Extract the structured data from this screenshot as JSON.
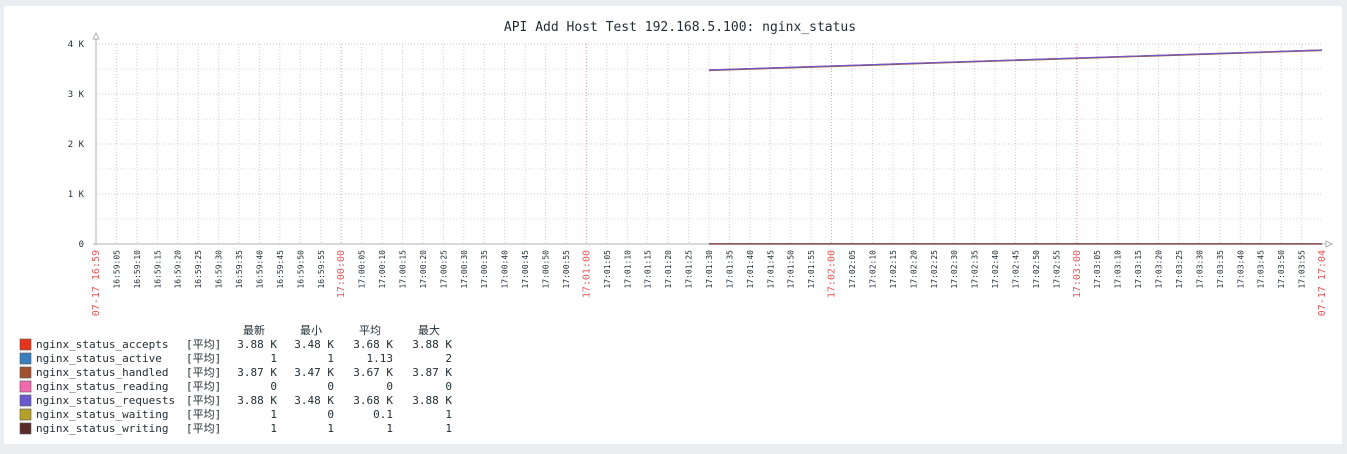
{
  "chart_data": {
    "type": "line",
    "title": "API Add Host Test 192.168.5.100: nginx_status",
    "y_ticks": [
      "0",
      "1 K",
      "2 K",
      "3 K",
      "4 K"
    ],
    "ylim": [
      0,
      4000
    ],
    "x_start_label": "07-17 16:59",
    "x_end_label": "07-17 17:04",
    "x_ticks": [
      "16:59:05",
      "16:59:10",
      "16:59:15",
      "16:59:20",
      "16:59:25",
      "16:59:30",
      "16:59:35",
      "16:59:40",
      "16:59:45",
      "16:59:50",
      "16:59:55",
      "17:00:00",
      "17:00:05",
      "17:00:10",
      "17:00:15",
      "17:00:20",
      "17:00:25",
      "17:00:30",
      "17:00:35",
      "17:00:40",
      "17:00:45",
      "17:00:50",
      "17:00:55",
      "17:01:00",
      "17:01:05",
      "17:01:10",
      "17:01:15",
      "17:01:20",
      "17:01:25",
      "17:01:30",
      "17:01:35",
      "17:01:40",
      "17:01:45",
      "17:01:50",
      "17:01:55",
      "17:02:00",
      "17:02:05",
      "17:02:10",
      "17:02:15",
      "17:02:20",
      "17:02:25",
      "17:02:30",
      "17:02:35",
      "17:02:40",
      "17:02:45",
      "17:02:50",
      "17:02:55",
      "17:03:00",
      "17:03:05",
      "17:03:10",
      "17:03:15",
      "17:03:20",
      "17:03:25",
      "17:03:30",
      "17:03:35",
      "17:03:40",
      "17:03:45",
      "17:03:50",
      "17:03:55"
    ],
    "major_ticks": [
      "17:00:00",
      "17:01:00",
      "17:02:00",
      "17:03:00"
    ],
    "data_start": "17:01:30",
    "data_end": "17:04:00",
    "grid": true,
    "legend_position": "bottom-left",
    "legend_headers": [
      "最新",
      "最小",
      "平均",
      "最大"
    ],
    "series": [
      {
        "name": "nginx_status_accepts",
        "func": "[平均]",
        "color": "#e8341c",
        "last": "3.88 K",
        "min": "3.48 K",
        "avg": "3.68 K",
        "max": "3.88 K",
        "start": 3480,
        "end": 3880
      },
      {
        "name": "nginx_status_active",
        "func": "[平均]",
        "color": "#3a7ebf",
        "last": "1",
        "min": "1",
        "avg": "1.13",
        "max": "2",
        "start": 1,
        "end": 1
      },
      {
        "name": "nginx_status_handled",
        "func": "[平均]",
        "color": "#a0522d",
        "last": "3.87 K",
        "min": "3.47 K",
        "avg": "3.67 K",
        "max": "3.87 K",
        "start": 3470,
        "end": 3870
      },
      {
        "name": "nginx_status_reading",
        "func": "[平均]",
        "color": "#f06ab0",
        "last": "0",
        "min": "0",
        "avg": "0",
        "max": "0",
        "start": 0,
        "end": 0
      },
      {
        "name": "nginx_status_requests",
        "func": "[平均]",
        "color": "#6a5acd",
        "last": "3.88 K",
        "min": "3.48 K",
        "avg": "3.68 K",
        "max": "3.88 K",
        "start": 3480,
        "end": 3880
      },
      {
        "name": "nginx_status_waiting",
        "func": "[平均]",
        "color": "#b5a02a",
        "last": "1",
        "min": "0",
        "avg": "0.1",
        "max": "1",
        "start": 1,
        "end": 1
      },
      {
        "name": "nginx_status_writing",
        "func": "[平均]",
        "color": "#5a2a2a",
        "last": "1",
        "min": "1",
        "avg": "1",
        "max": "1",
        "start": 1,
        "end": 1
      }
    ]
  }
}
